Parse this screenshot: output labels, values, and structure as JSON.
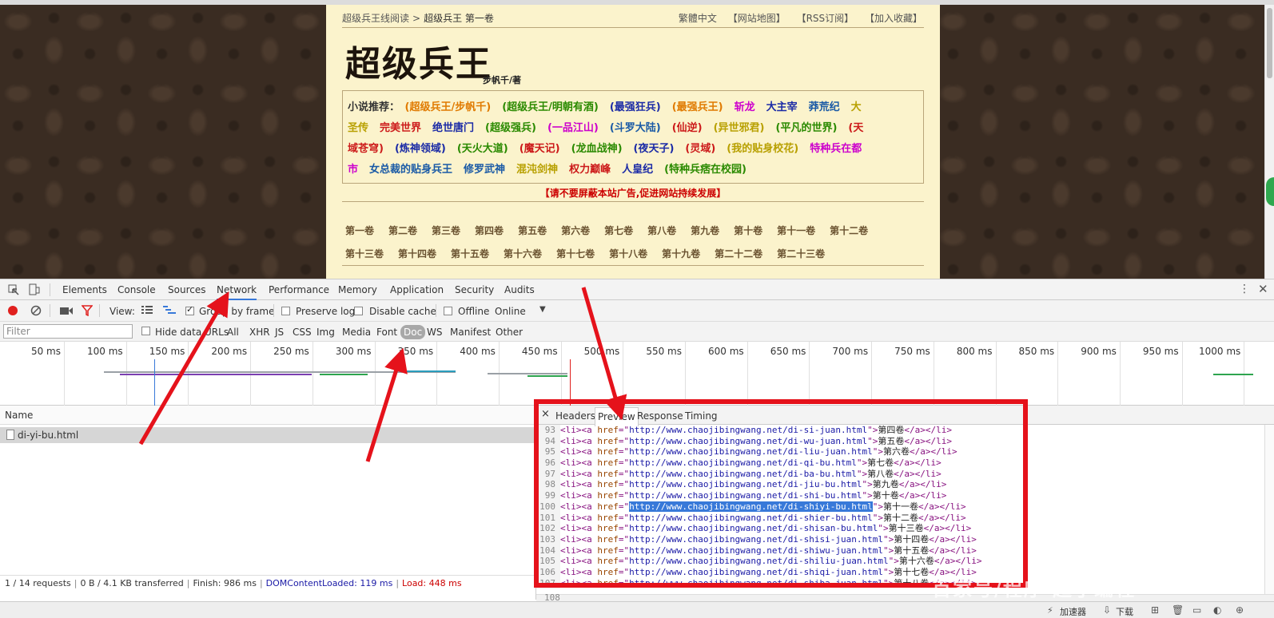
{
  "page": {
    "breadcrumb": {
      "site": "超级兵王线阅读",
      "sep": ">",
      "current": "超级兵王 第一卷"
    },
    "top_links": [
      "繁體中文",
      "【网站地图】",
      "【RSS订阅】",
      "【加入收藏】"
    ],
    "title": "超级兵王",
    "author": "步帆千/著",
    "recommend_label": "小说推荐：",
    "recommend_rows": [
      [
        {
          "text": "(超级兵王/步帆千)",
          "color": "#e07a00"
        },
        {
          "text": "(超级兵王/明朝有酒)",
          "color": "#2a8a00"
        },
        {
          "text": "(最强狂兵)",
          "color": "#1a2aa6"
        },
        {
          "text": "(最强兵王)",
          "color": "#e07a00"
        },
        {
          "text": "斩龙",
          "color": "#cc00cc"
        },
        {
          "text": "大主宰",
          "color": "#1a2aa6"
        },
        {
          "text": "莽荒纪",
          "color": "#1a5aa6"
        },
        {
          "text": "大",
          "color": "#b8a000"
        }
      ],
      [
        {
          "text": "圣传",
          "color": "#b8a000"
        },
        {
          "text": "完美世界",
          "color": "#cc1a1a"
        },
        {
          "text": "绝世唐门",
          "color": "#1a2aa6"
        },
        {
          "text": "(超级强兵)",
          "color": "#2a8a00"
        },
        {
          "text": "(一品江山)",
          "color": "#cc00cc"
        },
        {
          "text": "(斗罗大陆)",
          "color": "#1a5aa6"
        },
        {
          "text": "(仙逆)",
          "color": "#cc1a1a"
        },
        {
          "text": "(异世邪君)",
          "color": "#b8a000"
        },
        {
          "text": "(平凡的世界)",
          "color": "#2a8a00"
        },
        {
          "text": "(天",
          "color": "#cc1a1a"
        }
      ],
      [
        {
          "text": "域苍穹)",
          "color": "#cc1a1a"
        },
        {
          "text": "(炼神领域)",
          "color": "#1a2aa6"
        },
        {
          "text": "(天火大道)",
          "color": "#2a8a00"
        },
        {
          "text": "(魔天记)",
          "color": "#cc1a1a"
        },
        {
          "text": "(龙血战神)",
          "color": "#2a8a00"
        },
        {
          "text": "(夜天子)",
          "color": "#1a2aa6"
        },
        {
          "text": "(灵域)",
          "color": "#cc1a1a"
        },
        {
          "text": "(我的贴身校花)",
          "color": "#b8a000"
        },
        {
          "text": "特种兵在都",
          "color": "#cc00cc"
        }
      ],
      [
        {
          "text": "市",
          "color": "#cc00cc"
        },
        {
          "text": "女总裁的贴身兵王",
          "color": "#1a5aa6"
        },
        {
          "text": "修罗武神",
          "color": "#1a5aa6"
        },
        {
          "text": "混沌剑神",
          "color": "#b8a000"
        },
        {
          "text": "权力巅峰",
          "color": "#cc1a1a"
        },
        {
          "text": "人皇纪",
          "color": "#1a2aa6"
        },
        {
          "text": "(特种兵痞在校园)",
          "color": "#2a8a00"
        }
      ]
    ],
    "notice": "【请不要屏蔽本站广告,促进网站持续发展】",
    "chapters_row1": [
      "第一卷",
      "第二卷",
      "第三卷",
      "第四卷",
      "第五卷",
      "第六卷",
      "第七卷",
      "第八卷",
      "第九卷",
      "第十卷",
      "第十一卷",
      "第十二卷"
    ],
    "chapters_row2": [
      "第十三卷",
      "第十四卷",
      "第十五卷",
      "第十六卷",
      "第十七卷",
      "第十八卷",
      "第十九卷",
      "第二十二卷",
      "第二十三卷"
    ]
  },
  "devtools": {
    "tabs": [
      "Elements",
      "Console",
      "Sources",
      "Network",
      "Performance",
      "Memory",
      "Application",
      "Security",
      "Audits"
    ],
    "active_tab": "Network",
    "toolbar": {
      "view_label": "View:",
      "group_by_frame": "Group by frame",
      "preserve_log": "Preserve log",
      "disable_cache": "Disable cache",
      "offline": "Offline",
      "throttle": "Online"
    },
    "filter": {
      "placeholder": "Filter",
      "hide_data_urls": "Hide data URLs",
      "types": [
        "All",
        "XHR",
        "JS",
        "CSS",
        "Img",
        "Media",
        "Font",
        "Doc",
        "WS",
        "Manifest",
        "Other"
      ],
      "active_type": "Doc"
    },
    "timeline_ticks": [
      "50 ms",
      "100 ms",
      "150 ms",
      "200 ms",
      "250 ms",
      "300 ms",
      "350 ms",
      "400 ms",
      "450 ms",
      "500 ms",
      "550 ms",
      "600 ms",
      "650 ms",
      "700 ms",
      "750 ms",
      "800 ms",
      "850 ms",
      "900 ms",
      "950 ms",
      "1000 ms"
    ],
    "name_header": "Name",
    "requests": [
      "di-yi-bu.html"
    ],
    "preview_tabs": [
      "Headers",
      "Preview",
      "Response",
      "Timing"
    ],
    "preview_active": "Preview",
    "close_glyph": "×",
    "code_lines": [
      {
        "n": "93",
        "url": "http://www.chaojibingwang.net/di-si-juan.html",
        "text": "第四卷"
      },
      {
        "n": "94",
        "url": "http://www.chaojibingwang.net/di-wu-juan.html",
        "text": "第五卷"
      },
      {
        "n": "95",
        "url": "http://www.chaojibingwang.net/di-liu-juan.html",
        "text": "第六卷"
      },
      {
        "n": "96",
        "url": "http://www.chaojibingwang.net/di-qi-bu.html",
        "text": "第七卷"
      },
      {
        "n": "97",
        "url": "http://www.chaojibingwang.net/di-ba-bu.html",
        "text": "第八卷"
      },
      {
        "n": "98",
        "url": "http://www.chaojibingwang.net/di-jiu-bu.html",
        "text": "第九卷"
      },
      {
        "n": "99",
        "url": "http://www.chaojibingwang.net/di-shi-bu.html",
        "text": "第十卷"
      },
      {
        "n": "100",
        "url": "http://www.chaojibingwang.net/di-shiyi-bu.html",
        "text": "第十一卷",
        "highlight": true
      },
      {
        "n": "101",
        "url": "http://www.chaojibingwang.net/di-shier-bu.html",
        "text": "第十二卷"
      },
      {
        "n": "102",
        "url": "http://www.chaojibingwang.net/di-shisan-bu.html",
        "text": "第十三卷"
      },
      {
        "n": "103",
        "url": "http://www.chaojibingwang.net/di-shisi-juan.html",
        "text": "第十四卷"
      },
      {
        "n": "104",
        "url": "http://www.chaojibingwang.net/di-shiwu-juan.html",
        "text": "第十五卷"
      },
      {
        "n": "105",
        "url": "http://www.chaojibingwang.net/di-shiliu-juan.html",
        "text": "第十六卷"
      },
      {
        "n": "106",
        "url": "http://www.chaojibingwang.net/di-shiqi-juan.html",
        "text": "第十七卷"
      },
      {
        "n": "107",
        "url": "http://www.chaojibingwang.net/di-shiba-juan.html",
        "text": "第十八卷"
      }
    ],
    "last_line_number": "108",
    "status": {
      "requests": "1 / 14 requests",
      "transferred": "0 B / 4.1 KB transferred",
      "finish": "Finish: 986 ms",
      "dom": "DOMContentLoaded: 119 ms",
      "load": "Load: 448 ms"
    }
  },
  "browser_bar": {
    "accelerator": "加速器",
    "download": "下载"
  },
  "watermark": "百家号/程序  超子编程",
  "colors": {
    "annotation": "#e5121b",
    "devtools_accent": "#3879d9",
    "page_bg": "#fbf3cc"
  }
}
